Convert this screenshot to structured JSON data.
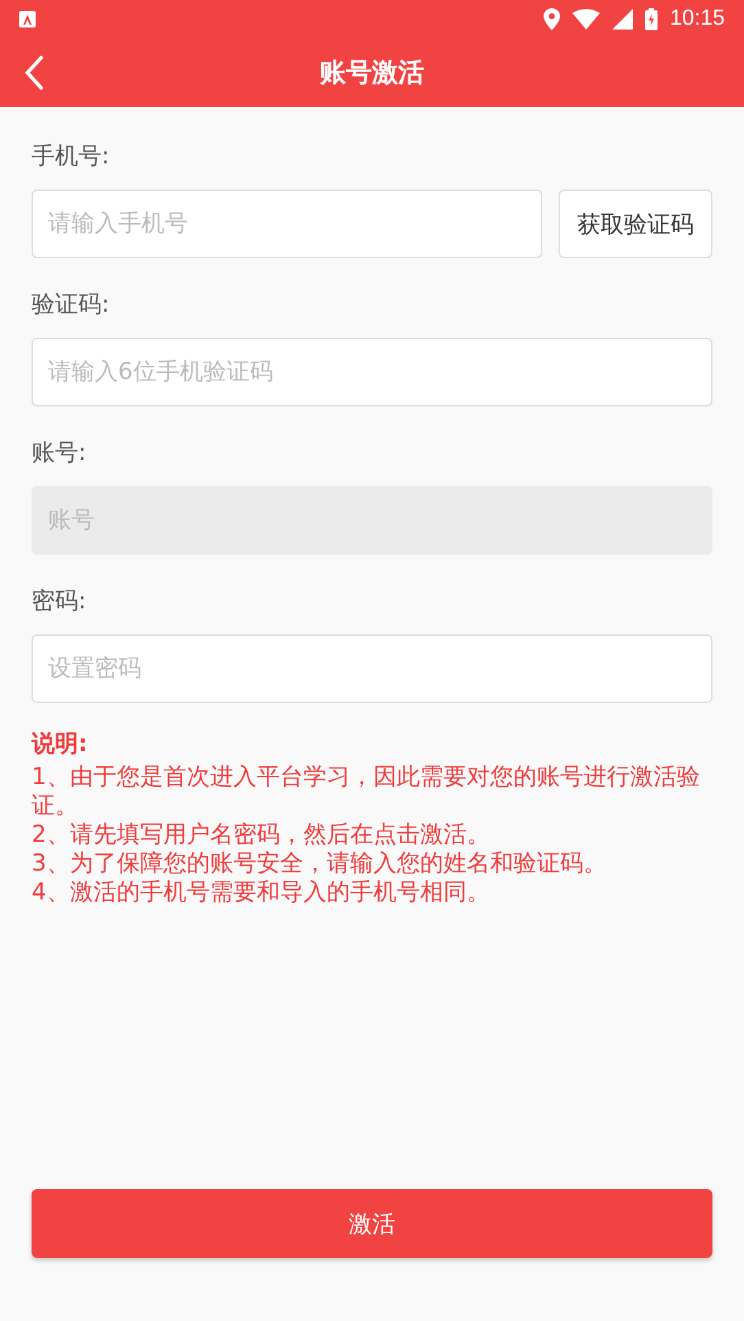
{
  "status_bar": {
    "time": "10:15"
  },
  "header": {
    "title": "账号激活"
  },
  "fields": [
    {
      "kind": "with_button",
      "label": "手机号:",
      "placeholder": "请输入手机号",
      "disabled": false,
      "button": "获取验证码"
    },
    {
      "kind": "plain",
      "label": "验证码:",
      "placeholder": "请输入6位手机验证码",
      "disabled": false
    },
    {
      "kind": "plain",
      "label": "账号:",
      "placeholder": "账号",
      "disabled": true
    },
    {
      "kind": "plain",
      "label": "密码:",
      "placeholder": "设置密码",
      "disabled": false
    }
  ],
  "notes": {
    "title": "说明:",
    "items": [
      "1、由于您是首次进入平台学习，因此需要对您的账号进行激活验证。",
      "2、请先填写用户名密码，然后在点击激活。",
      "3、为了保障您的账号安全，请输入您的姓名和验证码。",
      "4、激活的手机号需要和导入的手机号相同。"
    ]
  },
  "submit_button": "激活"
}
